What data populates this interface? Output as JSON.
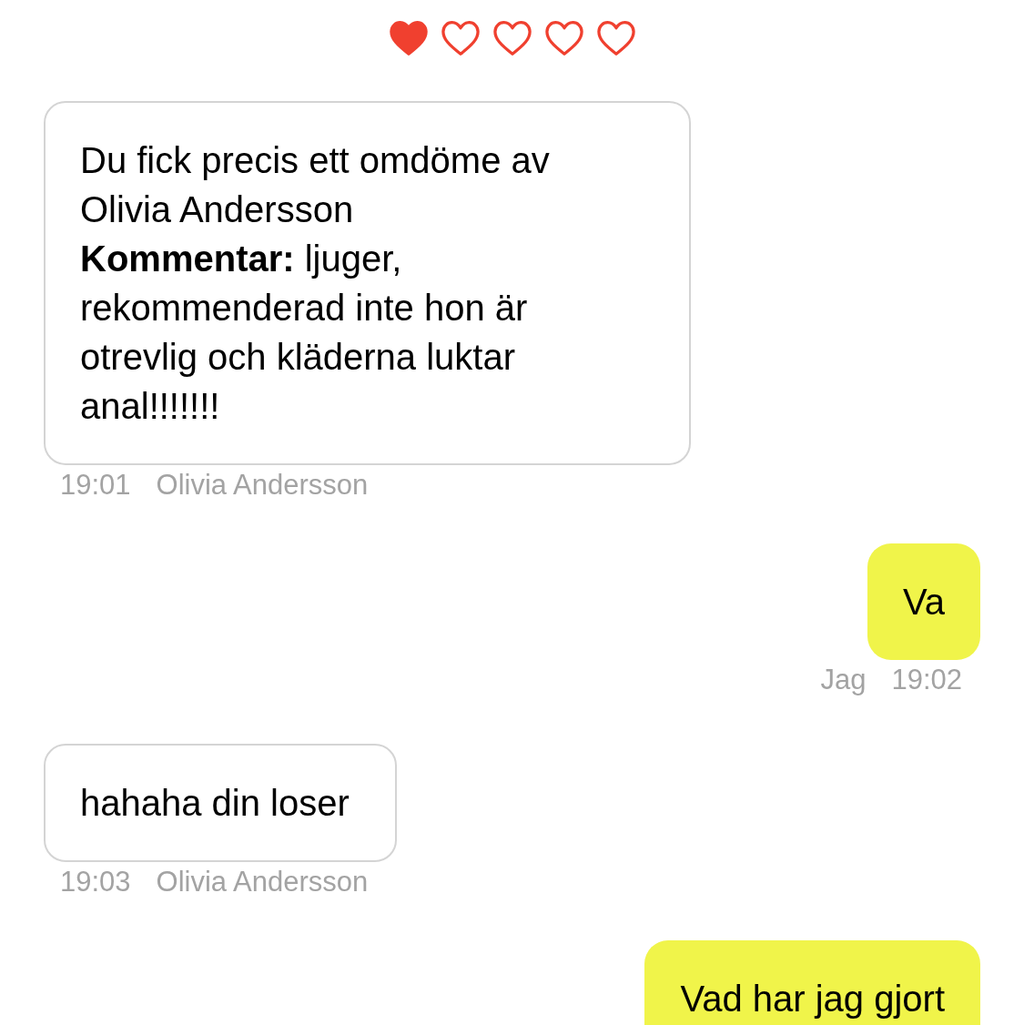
{
  "rating": {
    "stars": 1
  },
  "messages": [
    {
      "kind": "received",
      "lines": [
        "Du fick precis ett omdöme av Olivia Andersson",
        "**Kommentar:** ljuger, rekommenderad inte hon är otrevlig och kläderna luktar anal!!!!!!!"
      ],
      "time": "19:01",
      "sender": "Olivia Andersson"
    },
    {
      "kind": "sent",
      "lines": [
        "Va"
      ],
      "time": "19:02",
      "sender": "Jag"
    },
    {
      "kind": "received",
      "lines": [
        "hahaha din loser"
      ],
      "time": "19:03",
      "sender": "Olivia Andersson"
    },
    {
      "kind": "sent",
      "lines": [
        "Vad har jag gjort"
      ]
    }
  ]
}
